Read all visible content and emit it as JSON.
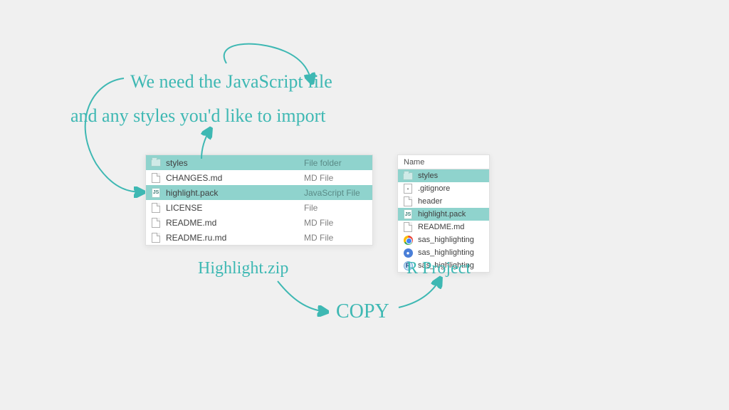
{
  "annotations": {
    "line1": "We need the JavaScript file",
    "line2": "and any styles you'd like to import",
    "label_left": "Highlight.zip",
    "label_right": "R Project",
    "action": "COPY"
  },
  "left_pane": {
    "items": [
      {
        "name": "styles",
        "type": "File folder",
        "selected": true,
        "icon": "folder"
      },
      {
        "name": "CHANGES.md",
        "type": "MD File",
        "selected": false,
        "icon": "file"
      },
      {
        "name": "highlight.pack",
        "type": "JavaScript File",
        "selected": true,
        "icon": "js"
      },
      {
        "name": "LICENSE",
        "type": "File",
        "selected": false,
        "icon": "file"
      },
      {
        "name": "README.md",
        "type": "MD File",
        "selected": false,
        "icon": "file"
      },
      {
        "name": "README.ru.md",
        "type": "MD File",
        "selected": false,
        "icon": "file"
      }
    ]
  },
  "right_pane": {
    "header": "Name",
    "items": [
      {
        "name": "styles",
        "selected": true,
        "icon": "folder"
      },
      {
        "name": ".gitignore",
        "selected": false,
        "icon": "dot"
      },
      {
        "name": "header",
        "selected": false,
        "icon": "file"
      },
      {
        "name": "highlight.pack",
        "selected": true,
        "icon": "js"
      },
      {
        "name": "README.md",
        "selected": false,
        "icon": "file"
      },
      {
        "name": "sas_highlighting",
        "selected": false,
        "icon": "chrome"
      },
      {
        "name": "sas_highlighting",
        "selected": false,
        "icon": "blue"
      },
      {
        "name": "sas_highlighting",
        "selected": false,
        "icon": "r"
      }
    ]
  }
}
